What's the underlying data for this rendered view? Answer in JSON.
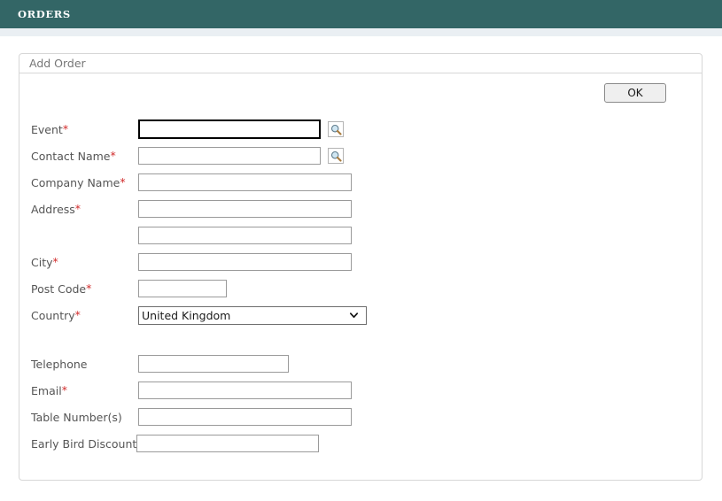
{
  "banner": {
    "title": "ORDERS",
    "background_color": "#336666",
    "text_color": "#ffffff",
    "strip_color": "#eaeff3"
  },
  "panel": {
    "title": "Add Order"
  },
  "actions": {
    "ok_label": "OK"
  },
  "required_marker": "*",
  "accent": {
    "required_star_color": "#d12b2b",
    "label_color": "#555555",
    "focused_border_color": "#000000"
  },
  "icons": {
    "search": "search-icon",
    "chevron_down": "chevron-down-icon"
  },
  "form": {
    "fields": [
      {
        "key": "event",
        "label": "Event",
        "required": true,
        "type": "text",
        "value": "",
        "placeholder": "",
        "focused": true,
        "has_lookup": true
      },
      {
        "key": "contact_name",
        "label": "Contact Name",
        "required": true,
        "type": "text",
        "value": "",
        "placeholder": "",
        "focused": false,
        "has_lookup": true
      },
      {
        "key": "company_name",
        "label": "Company Name",
        "required": true,
        "type": "text",
        "value": "",
        "placeholder": "",
        "focused": false,
        "has_lookup": false
      },
      {
        "key": "address_line_1",
        "label": "Address",
        "required": true,
        "type": "text",
        "value": "",
        "placeholder": "",
        "focused": false,
        "has_lookup": false
      },
      {
        "key": "address_line_2",
        "label": "",
        "required": false,
        "type": "text",
        "value": "",
        "placeholder": "",
        "focused": false,
        "has_lookup": false
      },
      {
        "key": "city",
        "label": "City",
        "required": true,
        "type": "text",
        "value": "",
        "placeholder": "",
        "focused": false,
        "has_lookup": false
      },
      {
        "key": "post_code",
        "label": "Post Code",
        "required": true,
        "type": "text",
        "value": "",
        "placeholder": "",
        "focused": false,
        "has_lookup": false
      },
      {
        "key": "country",
        "label": "Country",
        "required": true,
        "type": "select",
        "value": "United Kingdom",
        "options": [
          "United Kingdom"
        ],
        "focused": false,
        "has_lookup": false
      },
      {
        "key": "telephone",
        "label": "Telephone",
        "required": false,
        "type": "text",
        "value": "",
        "placeholder": "",
        "focused": false,
        "has_lookup": false
      },
      {
        "key": "email",
        "label": "Email",
        "required": true,
        "type": "text",
        "value": "",
        "placeholder": "",
        "focused": false,
        "has_lookup": false
      },
      {
        "key": "table_numbers",
        "label": "Table Number(s)",
        "required": false,
        "type": "text",
        "value": "",
        "placeholder": "",
        "focused": false,
        "has_lookup": false
      },
      {
        "key": "early_bird_discount",
        "label": "Early Bird Discount",
        "required": false,
        "type": "text",
        "value": "",
        "placeholder": "",
        "focused": false,
        "has_lookup": false
      }
    ]
  }
}
